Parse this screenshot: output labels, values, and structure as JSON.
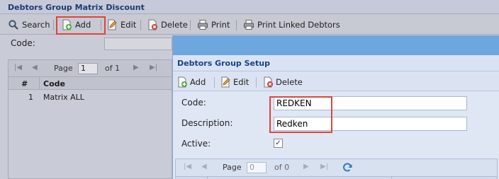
{
  "background": {
    "title": "Debtors Group Matrix Discount",
    "toolbar": {
      "search": "Search",
      "add": "Add",
      "edit": "Edit",
      "delete": "Delete",
      "print": "Print",
      "print_linked": "Print Linked Debtors"
    },
    "code_label": "Code:",
    "pager": {
      "page_label": "Page",
      "page_value": "1",
      "of_label": "of 1"
    },
    "grid": {
      "columns": [
        "#",
        "Code"
      ],
      "rows": [
        {
          "no": "1",
          "code": "Matrix ALL"
        }
      ]
    }
  },
  "modal": {
    "title": "Debtors Group Setup",
    "toolbar": {
      "add": "Add",
      "edit": "Edit",
      "delete": "Delete"
    },
    "form": {
      "code_label": "Code:",
      "code_value": "REDKEN",
      "description_label": "Description:",
      "description_value": "Redken",
      "active_label": "Active:",
      "active_checked": "✓"
    },
    "pager": {
      "page_label": "Page",
      "page_value": "0",
      "of_label": "of 0"
    }
  },
  "colors": {
    "modal_header": "#6ea7de",
    "title_text": "#15428b",
    "highlight": "#e0443d"
  },
  "icons": [
    "search-icon",
    "add-icon",
    "edit-icon",
    "delete-icon",
    "print-icon",
    "refresh-icon"
  ]
}
